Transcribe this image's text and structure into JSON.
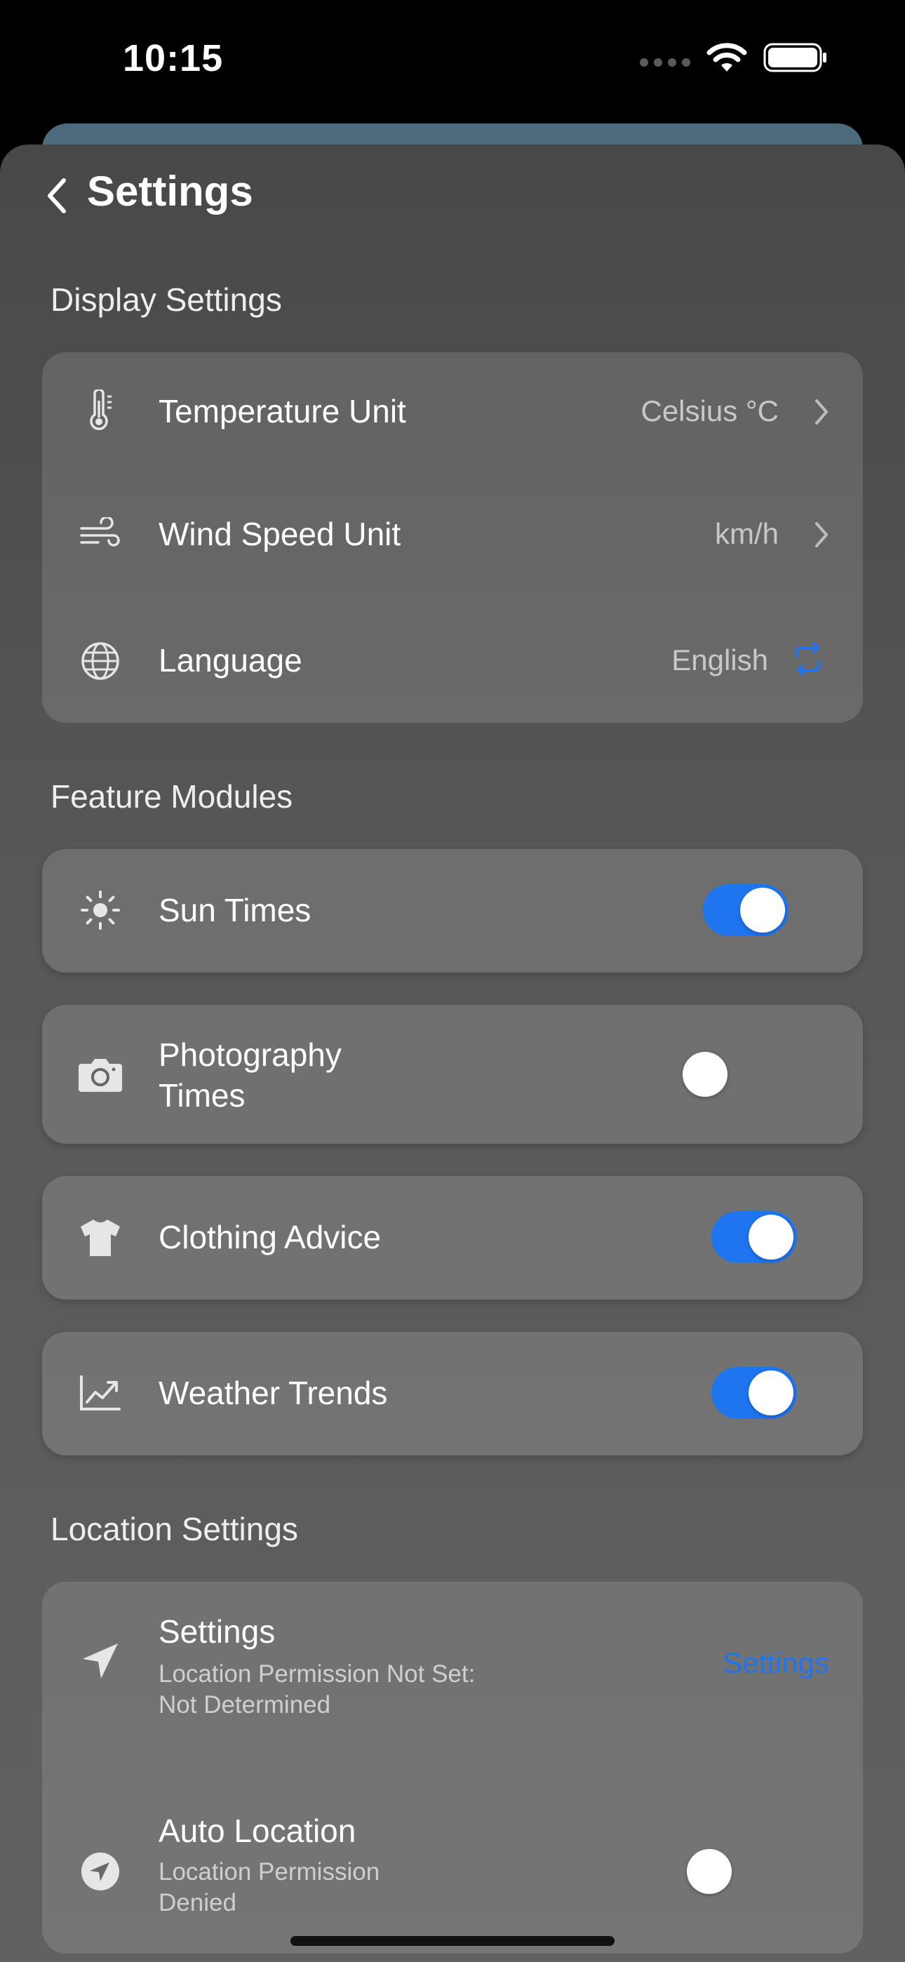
{
  "status_bar": {
    "time": "10:15"
  },
  "nav": {
    "title": "Settings"
  },
  "display_settings": {
    "title": "Display Settings",
    "temperature": {
      "label": "Temperature Unit",
      "value": "Celsius °C",
      "icon": "thermometer-icon"
    },
    "wind": {
      "label": "Wind Speed Unit",
      "value": "km/h",
      "icon": "wind-icon"
    },
    "language": {
      "label": "Language",
      "value": "English",
      "icon": "globe-icon",
      "action_icon": "refresh-icon"
    }
  },
  "feature_modules": {
    "title": "Feature Modules",
    "items": [
      {
        "label": "Sun Times",
        "enabled": true,
        "icon": "sun-icon"
      },
      {
        "label": "Photography Times",
        "label_line1": "Photography",
        "label_line2": "Times",
        "enabled": false,
        "icon": "camera-icon"
      },
      {
        "label": "Clothing Advice",
        "enabled": true,
        "icon": "tshirt-icon"
      },
      {
        "label": "Weather Trends",
        "enabled": true,
        "icon": "chart-line-icon"
      }
    ]
  },
  "location_settings": {
    "title": "Location Settings",
    "permission": {
      "label": "Settings",
      "sub_line1": "Location Permission Not Set:",
      "sub_line2": "Not Determined",
      "link": "Settings",
      "icon": "location-arrow-icon"
    },
    "auto_location": {
      "label": "Auto Location",
      "sub_line1": "Location Permission",
      "sub_line2": "Denied",
      "enabled": false,
      "icon": "location-circle-icon"
    }
  },
  "colors": {
    "accent": "#1f75f0",
    "sheet_background": "#555555",
    "card_background": "rgba(255,255,255,0.13)",
    "top_card": "#4d6b7c"
  }
}
